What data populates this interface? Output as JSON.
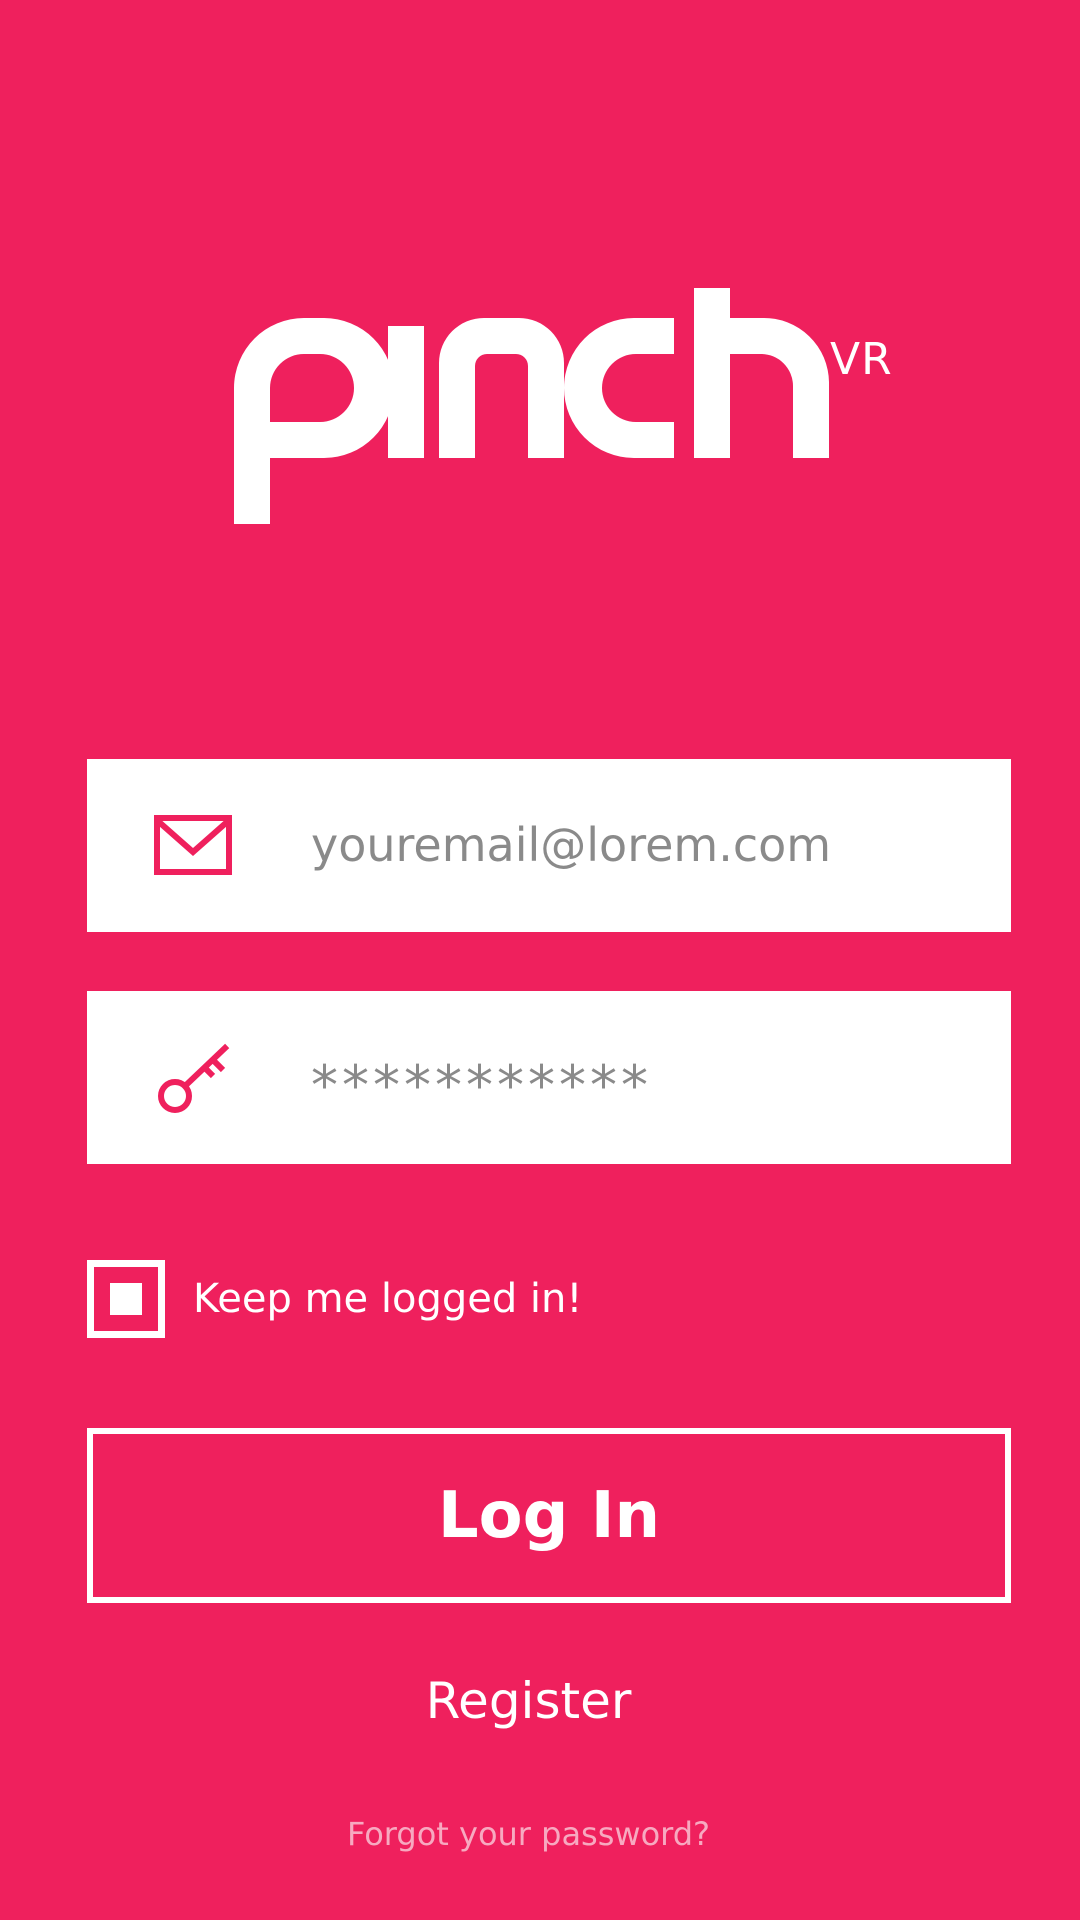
{
  "app": {
    "logo_text": "pinch",
    "logo_superscript": "VR"
  },
  "login_form": {
    "email_field": {
      "value": "youremail@lorem.com",
      "icon": "envelope-icon"
    },
    "password_field": {
      "value": "***********",
      "icon": "key-icon"
    },
    "keep_logged_in": {
      "label": "Keep me logged in!",
      "checked": true
    },
    "login_button_label": "Log In",
    "register_link": "Register",
    "forgot_password_link": "Forgot your password?"
  },
  "colors": {
    "background": "#EF205D",
    "field_background": "#ffffff",
    "field_text": "#8A8A8A",
    "accent_icon": "#EF205D",
    "muted_link": "#F7A9C0"
  }
}
